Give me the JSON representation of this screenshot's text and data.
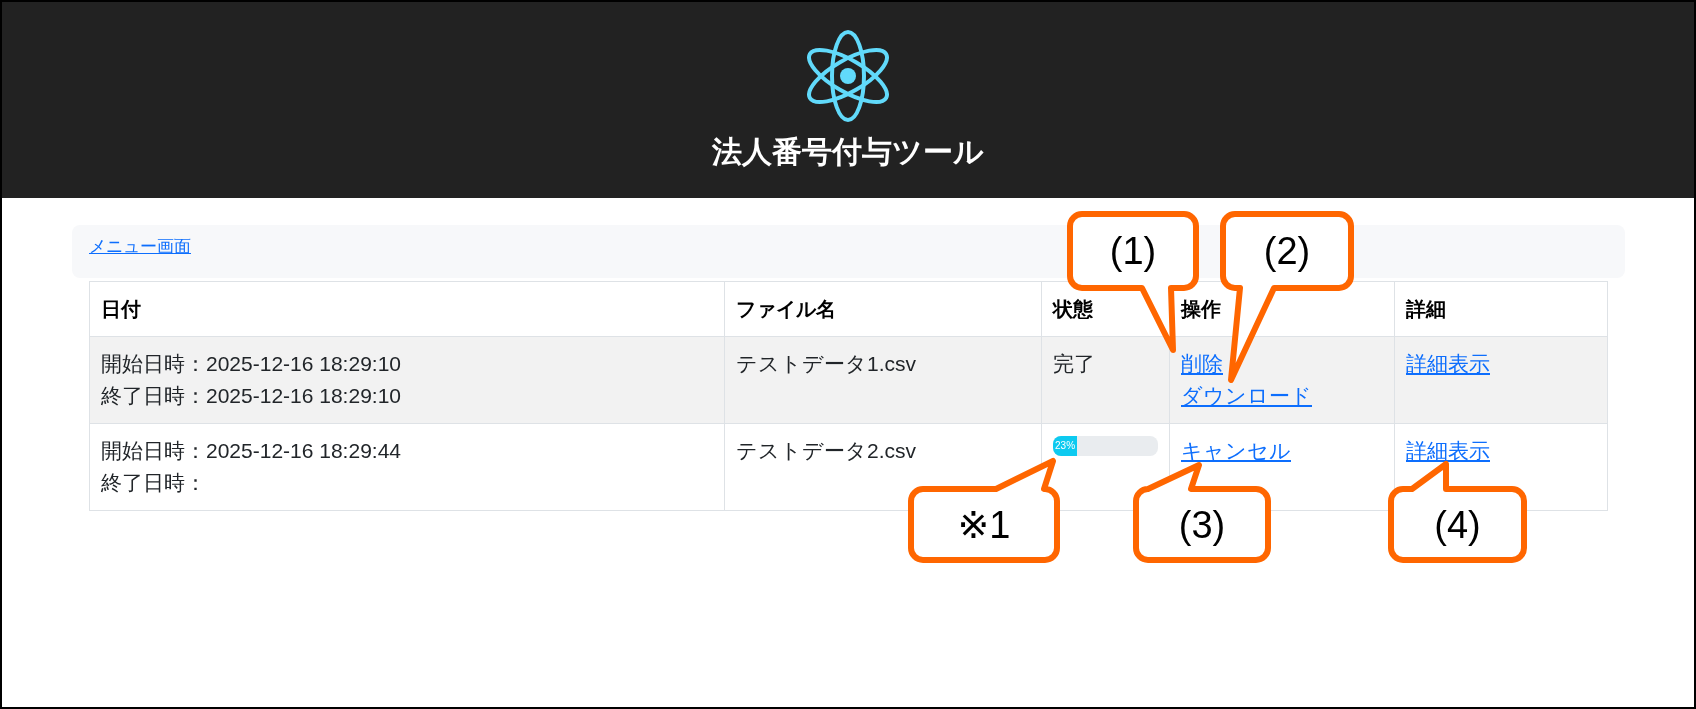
{
  "header": {
    "title": "法人番号付与ツール"
  },
  "breadcrumb": {
    "link": "メニュー画面"
  },
  "table": {
    "columns": [
      "日付",
      "ファイル名",
      "状態",
      "操作",
      "詳細"
    ],
    "rows": [
      {
        "start": "開始日時：2025-12-16 18:29:10",
        "end": "終了日時：2025-12-16 18:29:10",
        "file": "テストデータ1.csv",
        "status": {
          "kind": "text",
          "text": "完了"
        },
        "actions": [
          "削除",
          "ダウンロード"
        ],
        "detail": "詳細表示"
      },
      {
        "start": "開始日時：2025-12-16 18:29:44",
        "end": "終了日時：",
        "file": "テストデータ2.csv",
        "status": {
          "kind": "progress",
          "level": 0.23,
          "label": "23%"
        },
        "actions": [
          "キャンセル"
        ],
        "detail": "詳細表示"
      }
    ]
  },
  "callouts": [
    {
      "label": "(1)"
    },
    {
      "label": "(2)"
    },
    {
      "label": "※1"
    },
    {
      "label": "(3)"
    },
    {
      "label": "(4)"
    }
  ]
}
